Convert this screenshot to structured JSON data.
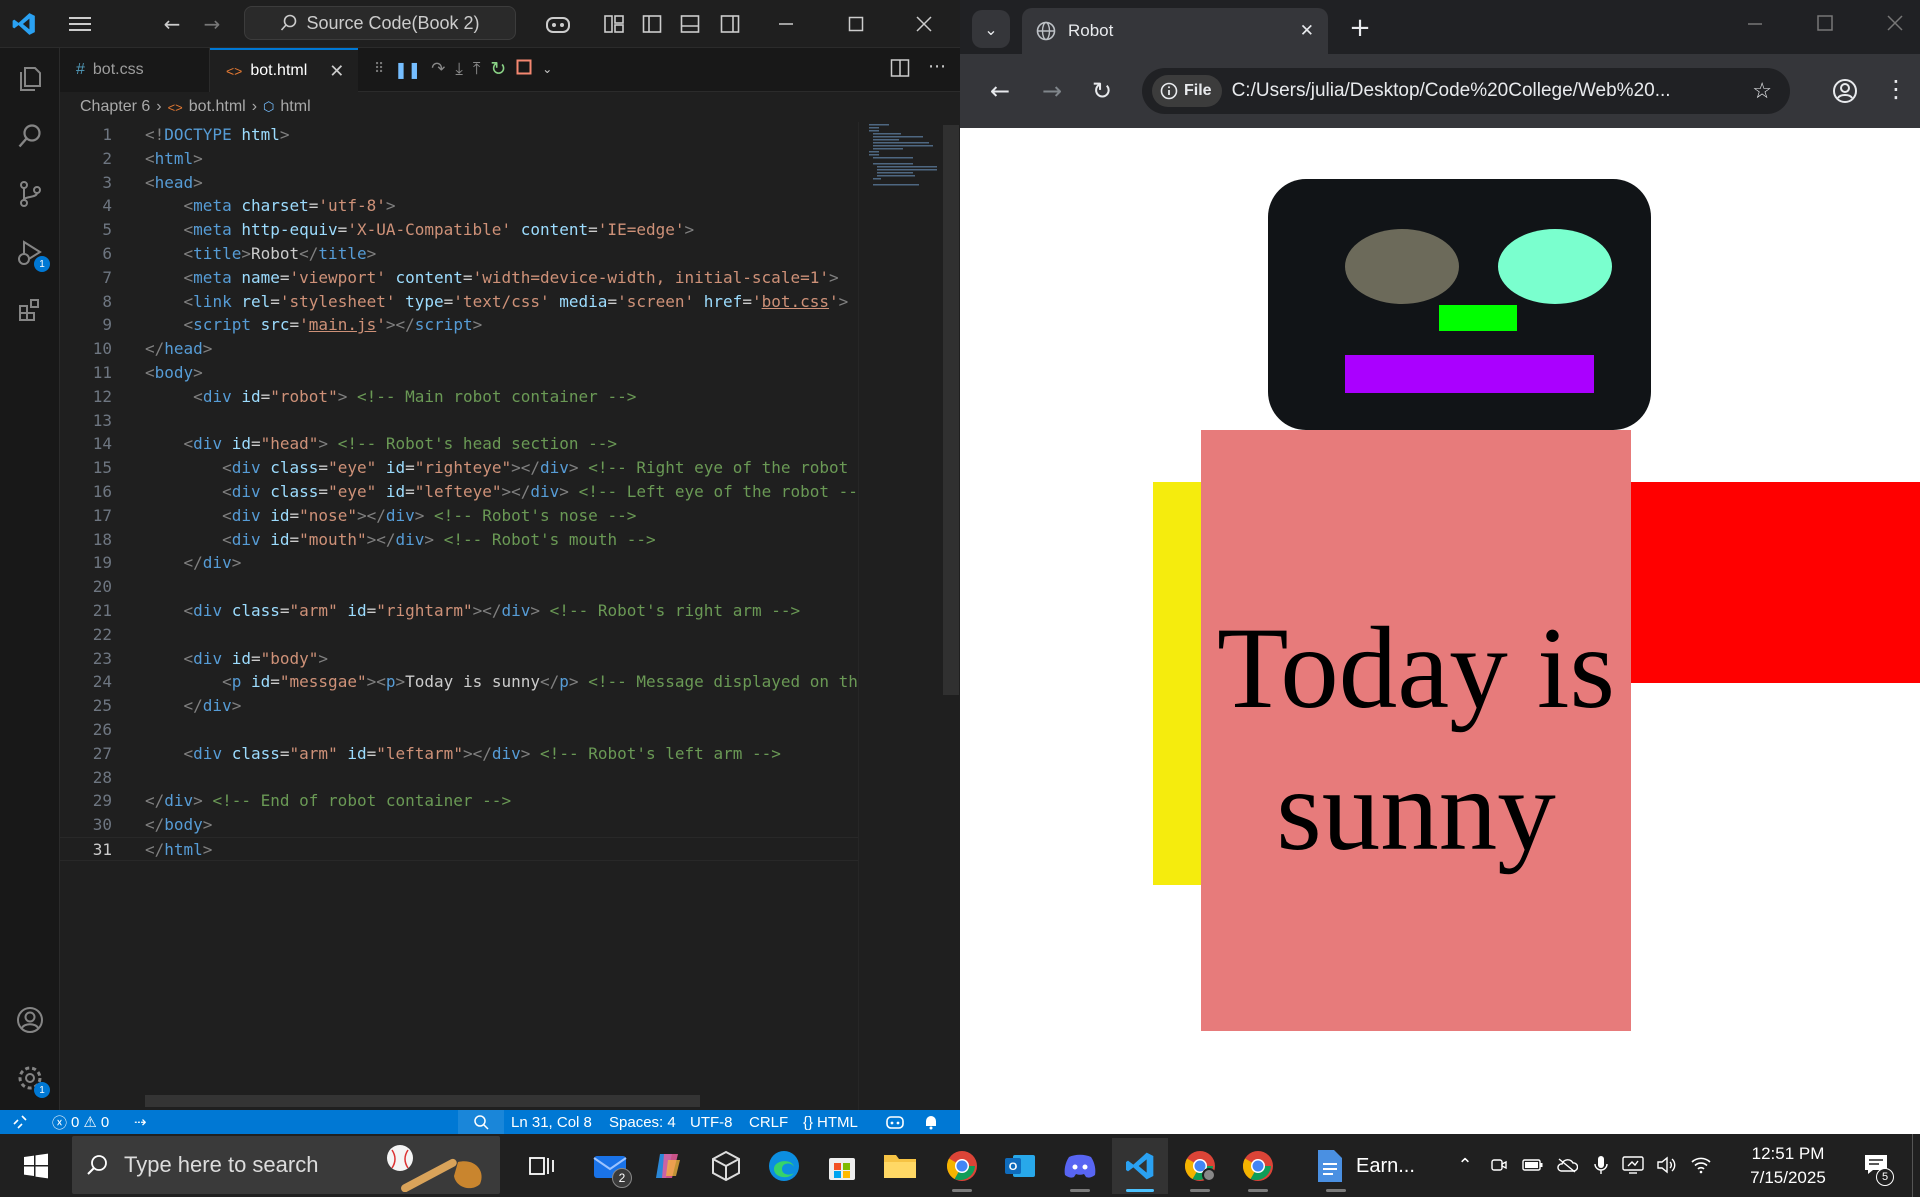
{
  "vscode": {
    "command_center": "Source Code(Book 2)",
    "tabs": [
      {
        "label": "bot.css",
        "icon": "#"
      },
      {
        "label": "bot.html",
        "icon": "<>"
      }
    ],
    "breadcrumb": [
      "Chapter 6",
      "bot.html",
      "html"
    ],
    "activity_badges": {
      "debug": "1",
      "settings": "1"
    },
    "code_lines": [
      {
        "n": "1",
        "html": "<span class='t'>&lt;!</span><span class='tag'>DOCTYPE</span> <span class='attr'>html</span><span class='t'>&gt;</span>"
      },
      {
        "n": "2",
        "html": "<span class='t'>&lt;</span><span class='tag'>html</span><span class='t'>&gt;</span>"
      },
      {
        "n": "3",
        "html": "<span class='t'>&lt;</span><span class='tag'>head</span><span class='t'>&gt;</span>"
      },
      {
        "n": "4",
        "html": "    <span class='t'>&lt;</span><span class='tag'>meta</span> <span class='attr'>charset</span>=<span class='str'>'utf-8'</span><span class='t'>&gt;</span>"
      },
      {
        "n": "5",
        "html": "    <span class='t'>&lt;</span><span class='tag'>meta</span> <span class='attr'>http-equiv</span>=<span class='str'>'X-UA-Compatible'</span> <span class='attr'>content</span>=<span class='str'>'IE=edge'</span><span class='t'>&gt;</span>"
      },
      {
        "n": "6",
        "html": "    <span class='t'>&lt;</span><span class='tag'>title</span><span class='t'>&gt;</span><span class='tx'>Robot</span><span class='t'>&lt;/</span><span class='tag'>title</span><span class='t'>&gt;</span>"
      },
      {
        "n": "7",
        "html": "    <span class='t'>&lt;</span><span class='tag'>meta</span> <span class='attr'>name</span>=<span class='str'>'viewport'</span> <span class='attr'>content</span>=<span class='str'>'width=device-width, initial-scale=1'</span><span class='t'>&gt;</span>"
      },
      {
        "n": "8",
        "html": "    <span class='t'>&lt;</span><span class='tag'>link</span> <span class='attr'>rel</span>=<span class='str'>'stylesheet'</span> <span class='attr'>type</span>=<span class='str'>'text/css'</span> <span class='attr'>media</span>=<span class='str'>'screen'</span> <span class='attr'>href</span>=<span class='str'>'<span class=\"u\">bot.css</span>'</span><span class='t'>&gt;</span>"
      },
      {
        "n": "9",
        "html": "    <span class='t'>&lt;</span><span class='tag'>script</span> <span class='attr'>src</span>=<span class='str'>'<span class=\"u\">main.js</span>'</span><span class='t'>&gt;&lt;/</span><span class='tag'>script</span><span class='t'>&gt;</span>"
      },
      {
        "n": "10",
        "html": "<span class='t'>&lt;/</span><span class='tag'>head</span><span class='t'>&gt;</span>"
      },
      {
        "n": "11",
        "html": "<span class='t'>&lt;</span><span class='tag'>body</span><span class='t'>&gt;</span>"
      },
      {
        "n": "12",
        "html": "     <span class='t'>&lt;</span><span class='tag'>div</span> <span class='attr'>id</span>=<span class='str'>\"robot\"</span><span class='t'>&gt;</span> <span class='cm'>&lt;!-- Main robot container --&gt;</span>"
      },
      {
        "n": "13",
        "html": ""
      },
      {
        "n": "14",
        "html": "    <span class='t'>&lt;</span><span class='tag'>div</span> <span class='attr'>id</span>=<span class='str'>\"head\"</span><span class='t'>&gt;</span> <span class='cm'>&lt;!-- Robot's head section --&gt;</span>"
      },
      {
        "n": "15",
        "html": "        <span class='t'>&lt;</span><span class='tag'>div</span> <span class='attr'>class</span>=<span class='str'>\"eye\"</span> <span class='attr'>id</span>=<span class='str'>\"righteye\"</span><span class='t'>&gt;&lt;/</span><span class='tag'>div</span><span class='t'>&gt;</span> <span class='cm'>&lt;!-- Right eye of the robot</span>"
      },
      {
        "n": "16",
        "html": "        <span class='t'>&lt;</span><span class='tag'>div</span> <span class='attr'>class</span>=<span class='str'>\"eye\"</span> <span class='attr'>id</span>=<span class='str'>\"lefteye\"</span><span class='t'>&gt;&lt;/</span><span class='tag'>div</span><span class='t'>&gt;</span> <span class='cm'>&lt;!-- Left eye of the robot --</span>"
      },
      {
        "n": "17",
        "html": "        <span class='t'>&lt;</span><span class='tag'>div</span> <span class='attr'>id</span>=<span class='str'>\"nose\"</span><span class='t'>&gt;&lt;/</span><span class='tag'>div</span><span class='t'>&gt;</span> <span class='cm'>&lt;!-- Robot's nose --&gt;</span>"
      },
      {
        "n": "18",
        "html": "        <span class='t'>&lt;</span><span class='tag'>div</span> <span class='attr'>id</span>=<span class='str'>\"mouth\"</span><span class='t'>&gt;&lt;/</span><span class='tag'>div</span><span class='t'>&gt;</span> <span class='cm'>&lt;!-- Robot's mouth --&gt;</span>"
      },
      {
        "n": "19",
        "html": "    <span class='t'>&lt;/</span><span class='tag'>div</span><span class='t'>&gt;</span>"
      },
      {
        "n": "20",
        "html": ""
      },
      {
        "n": "21",
        "html": "    <span class='t'>&lt;</span><span class='tag'>div</span> <span class='attr'>class</span>=<span class='str'>\"arm\"</span> <span class='attr'>id</span>=<span class='str'>\"rightarm\"</span><span class='t'>&gt;&lt;/</span><span class='tag'>div</span><span class='t'>&gt;</span> <span class='cm'>&lt;!-- Robot's right arm --&gt;</span>"
      },
      {
        "n": "22",
        "html": ""
      },
      {
        "n": "23",
        "html": "    <span class='t'>&lt;</span><span class='tag'>div</span> <span class='attr'>id</span>=<span class='str'>\"body\"</span><span class='t'>&gt;</span>"
      },
      {
        "n": "24",
        "html": "        <span class='t'>&lt;</span><span class='tag'>p</span> <span class='attr'>id</span>=<span class='str'>\"messgae\"</span><span class='t'>&gt;&lt;</span><span class='tag'>p</span><span class='t'>&gt;</span><span class='tx'>Today is sunny</span><span class='t'>&lt;/</span><span class='tag'>p</span><span class='t'>&gt;</span> <span class='cm'>&lt;!-- Message displayed on the</span>"
      },
      {
        "n": "25",
        "html": "    <span class='t'>&lt;/</span><span class='tag'>div</span><span class='t'>&gt;</span>"
      },
      {
        "n": "26",
        "html": ""
      },
      {
        "n": "27",
        "html": "    <span class='t'>&lt;</span><span class='tag'>div</span> <span class='attr'>class</span>=<span class='str'>\"arm\"</span> <span class='attr'>id</span>=<span class='str'>\"leftarm\"</span><span class='t'>&gt;&lt;/</span><span class='tag'>div</span><span class='t'>&gt;</span> <span class='cm'>&lt;!-- Robot's left arm --&gt;</span>"
      },
      {
        "n": "28",
        "html": ""
      },
      {
        "n": "29",
        "html": "<span class='t'>&lt;/</span><span class='tag'>div</span><span class='t'>&gt;</span> <span class='cm'>&lt;!-- End of robot container --&gt;</span>"
      },
      {
        "n": "30",
        "html": "<span class='t'>&lt;/</span><span class='tag'>body</span><span class='t'>&gt;</span>"
      },
      {
        "n": "31",
        "html": "<span class='t'>&lt;/</span><span class='tag'>html</span><span class='t'>&gt;</span>"
      }
    ],
    "status": {
      "errors": "0",
      "warnings": "0",
      "position": "Ln 31, Col 8",
      "spaces": "Spaces: 4",
      "encoding": "UTF-8",
      "eol": "CRLF",
      "language": "HTML"
    }
  },
  "chrome": {
    "tab_title": "Robot",
    "chip_label": "File",
    "url": "C:/Users/julia/Desktop/Code%20College/Web%20...",
    "page": {
      "message": "Today is sunny"
    },
    "colors": {
      "robot_head": "#111417",
      "left_eye": "#6c6a5a",
      "right_eye": "#7affce",
      "nose": "#00ff00",
      "mouth": "#aa00ff",
      "body": "#e77b7b",
      "left_arm": "#f5ec0d",
      "right_arm": "#ff0000"
    }
  },
  "taskbar": {
    "search_placeholder": "Type here to search",
    "mail_badge": "2",
    "word_label": "Earn...",
    "clock_time": "12:51 PM",
    "clock_date": "7/15/2025",
    "notification_count": "5"
  }
}
